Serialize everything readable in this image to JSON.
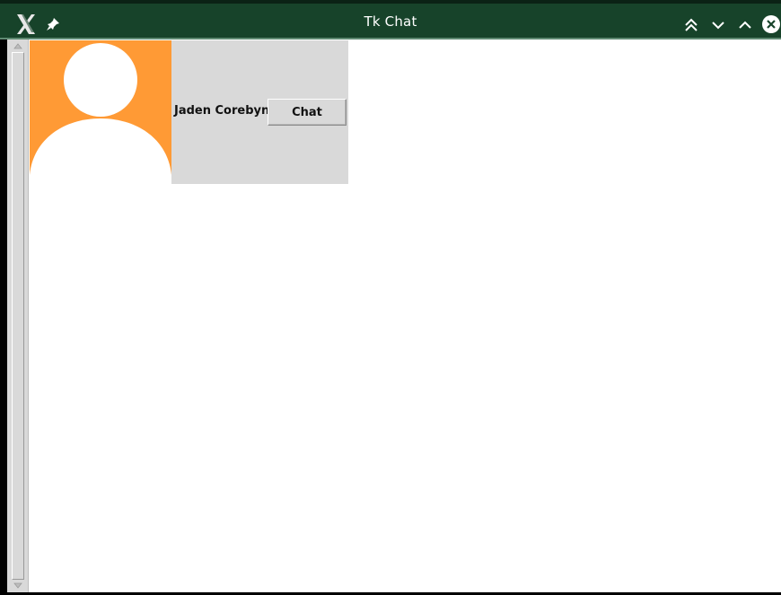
{
  "window": {
    "title": "Tk Chat"
  },
  "titlebar": {
    "icons": {
      "app": "x-logo-icon",
      "pin": "pin-icon",
      "shade": "shade-double-chevron-up-icon",
      "minimize": "chevron-down-icon",
      "maximize": "chevron-up-icon",
      "close": "close-icon"
    },
    "colors": {
      "background": "#17432a",
      "text": "#ffffff"
    }
  },
  "contacts": [
    {
      "name": "Jaden Corebyn",
      "button_label": "Chat",
      "avatar_icon": "person-silhouette-icon",
      "avatar_color": "#ff9a35"
    }
  ],
  "colors": {
    "panel": "#d9d9d9",
    "canvas": "#ffffff"
  }
}
